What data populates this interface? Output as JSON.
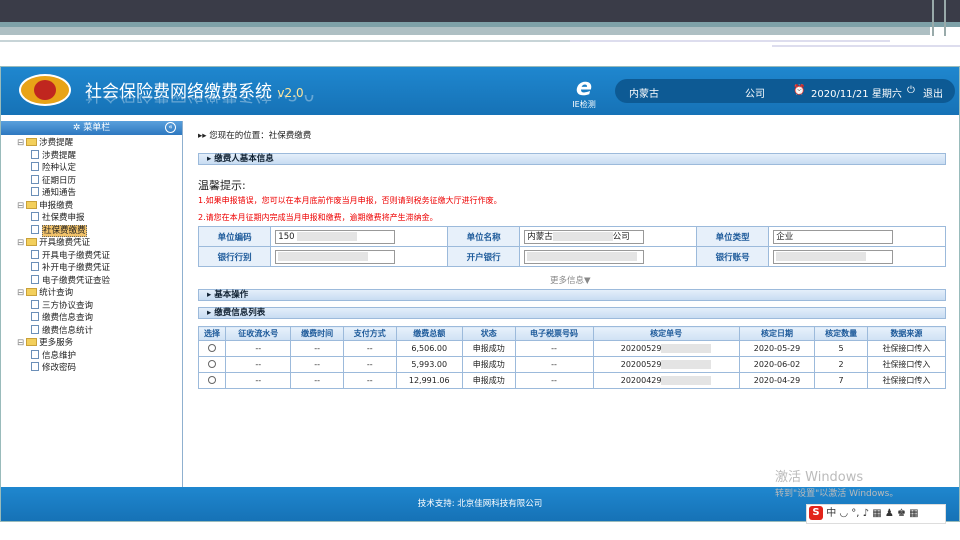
{
  "app": {
    "title": "社会保险费网络缴费系统",
    "version": "v2.0",
    "ie_check": "IE检测",
    "region": "内蒙古",
    "company_label": "公司",
    "datetime": "2020/11/21 星期六",
    "logout": "退出"
  },
  "sidebar": {
    "title": "菜单栏",
    "groups": [
      {
        "label": "涉费提醒",
        "items": [
          "涉费提醒",
          "险种认定",
          "征期日历",
          "通知通告"
        ]
      },
      {
        "label": "申报缴费",
        "items": [
          "社保费申报",
          "社保费缴费"
        ]
      },
      {
        "label": "开具缴费凭证",
        "items": [
          "开具电子缴费凭证",
          "补开电子缴费凭证",
          "电子缴费凭证查验"
        ]
      },
      {
        "label": "统计查询",
        "items": [
          "三方协议查询",
          "缴费信息查询",
          "缴费信息统计"
        ]
      },
      {
        "label": "更多服务",
        "items": [
          "信息维护",
          "修改密码"
        ]
      }
    ],
    "selected": "社保费缴费"
  },
  "main": {
    "breadcrumb": "您现在的位置：社保费缴费",
    "section_basic": "缴费人基本信息",
    "warm_title": "温馨提示:",
    "warn1": "1.如果申报错误，您可以在本月底前作废当月申报，否则请到税务征缴大厅进行作废。",
    "warn2": "2.请您在本月征期内完成当月申报和缴费，逾期缴费将产生滞纳金。",
    "labels": {
      "unit_code": "单位编码",
      "unit_name": "单位名称",
      "unit_type": "单位类型",
      "bank_branch": "银行行别",
      "open_bank": "开户银行",
      "bank_account": "银行账号"
    },
    "values": {
      "unit_code": "150",
      "unit_name_prefix": "内蒙古",
      "unit_name_suffix": "公司",
      "unit_type": "企业"
    },
    "more_info": "更多信息▼",
    "section_ops": "基本操作",
    "section_list": "缴费信息列表",
    "table": {
      "headers": [
        "选择",
        "征收流水号",
        "缴费时间",
        "支付方式",
        "缴费总额",
        "状态",
        "电子税票号码",
        "核定单号",
        "核定日期",
        "核定数量",
        "数据来源"
      ],
      "rows": [
        [
          "",
          "--",
          "--",
          "--",
          "6,506.00",
          "申报成功",
          "--",
          "20200529",
          "2020-05-29",
          "5",
          "社保接口传入"
        ],
        [
          "",
          "--",
          "--",
          "--",
          "5,993.00",
          "申报成功",
          "--",
          "20200529",
          "2020-06-02",
          "2",
          "社保接口传入"
        ],
        [
          "",
          "--",
          "--",
          "--",
          "12,991.06",
          "申报成功",
          "--",
          "20200429",
          "2020-04-29",
          "7",
          "社保接口传入"
        ]
      ]
    }
  },
  "footer": {
    "text": "技术支持: 北京佳网科技有限公司"
  },
  "windows": {
    "line1": "激活 Windows",
    "line2": "转到\"设置\"以激活 Windows。"
  },
  "ime": {
    "logo": "S",
    "text": "中 ◡ °, ♪ ▦ ♟ ♚ ▦"
  }
}
